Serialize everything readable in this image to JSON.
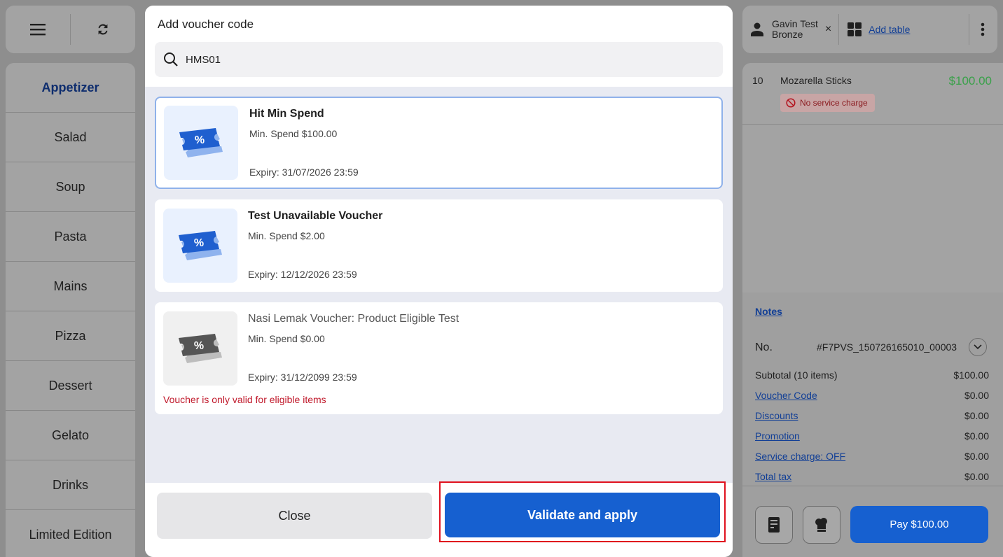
{
  "categories": [
    "Appetizer",
    "Salad",
    "Soup",
    "Pasta",
    "Mains",
    "Pizza",
    "Dessert",
    "Gelato",
    "Drinks",
    "Limited Edition"
  ],
  "customer": {
    "name": "Gavin Test",
    "tier": "Bronze",
    "clear": "×"
  },
  "header": {
    "add_table": "Add table"
  },
  "order_item": {
    "qty": "10",
    "name": "Mozarella Sticks",
    "price": "$100.00",
    "tag": "No service charge"
  },
  "summary": {
    "notes": "Notes",
    "no_label": "No.",
    "order_number": "#F7PVS_150726165010_00003",
    "subtotal_label": "Subtotal (10 items)",
    "subtotal_value": "$100.00",
    "voucher_label": "Voucher Code",
    "voucher_value": "$0.00",
    "discounts_label": "Discounts",
    "discounts_value": "$0.00",
    "promotion_label": "Promotion",
    "promotion_value": "$0.00",
    "service_label": "Service charge: OFF",
    "service_value": "$0.00",
    "tax_label": "Total tax",
    "tax_value": "$0.00",
    "pay_label": "Pay $100.00"
  },
  "modal": {
    "title": "Add voucher code",
    "search_value": "HMS01",
    "close_label": "Close",
    "apply_label": "Validate and apply",
    "vouchers": [
      {
        "name": "Hit Min Spend",
        "min_spend": "Min. Spend $100.00",
        "expiry": "Expiry: 31/07/2026 23:59",
        "icon_text": "%"
      },
      {
        "name": "Test Unavailable Voucher",
        "min_spend": "Min. Spend $2.00",
        "expiry": "Expiry: 12/12/2026 23:59",
        "icon_text": "%"
      },
      {
        "name": "Nasi Lemak Voucher: Product Eligible Test",
        "min_spend": "Min. Spend $0.00",
        "expiry": "Expiry: 31/12/2099 23:59",
        "icon_text": "%",
        "error": "Voucher is only valid for eligible items"
      }
    ]
  },
  "colors": {
    "primary": "#1660d0",
    "price_green": "#3aa14a",
    "error_red": "#c0182a",
    "highlight_red": "#e0111e"
  }
}
